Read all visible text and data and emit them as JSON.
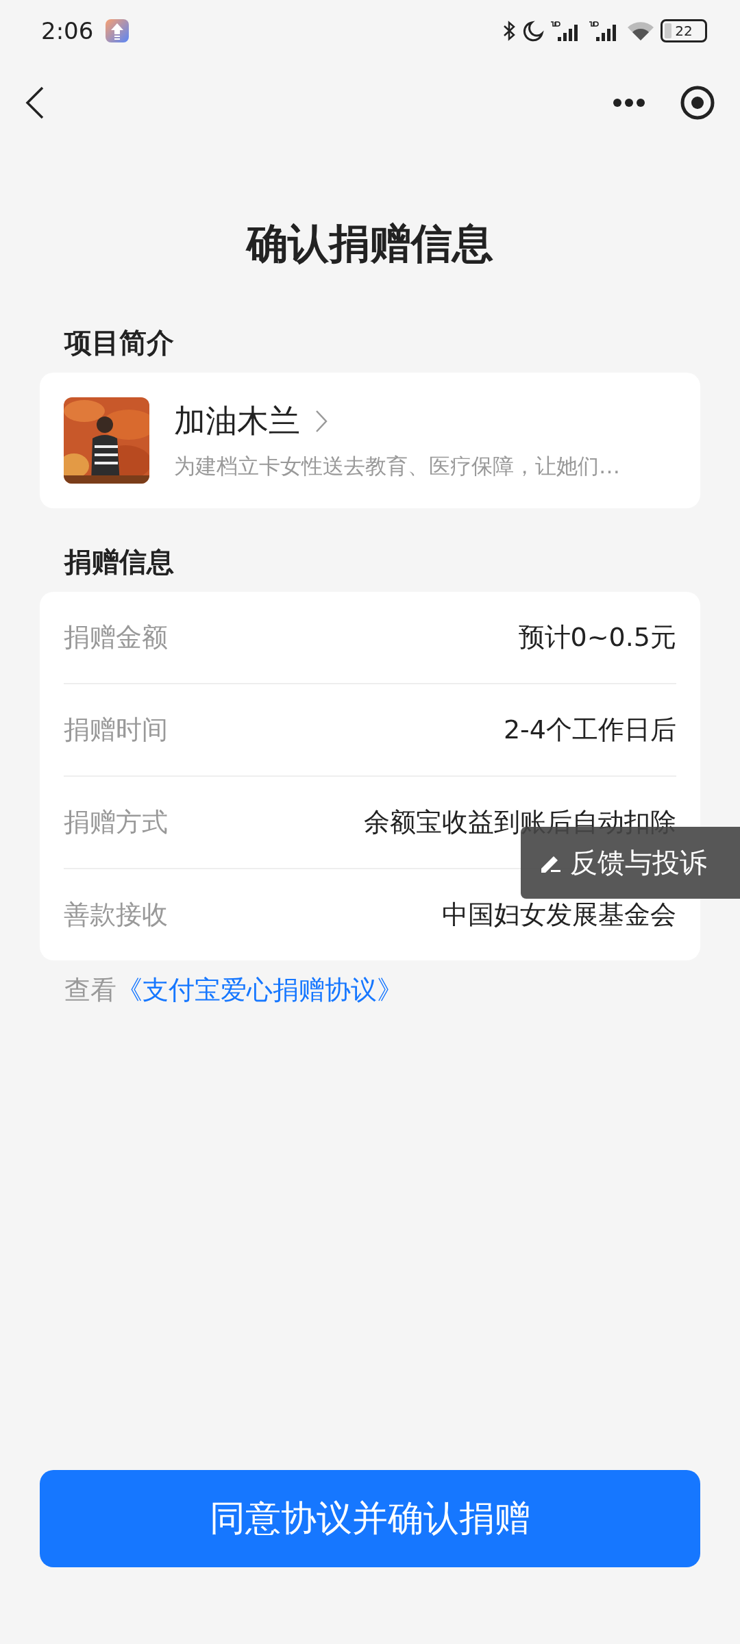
{
  "status_bar": {
    "time": "2:06",
    "battery": "22"
  },
  "page_title": "确认捐赠信息",
  "project_section": {
    "heading": "项目简介",
    "project": {
      "kind": "picture",
      "name": "加油木兰",
      "description": "为建档立卡女性送去教育、医疗保障，让她们…"
    }
  },
  "donation_section": {
    "heading": "捐赠信息",
    "rows": [
      {
        "label": "捐赠金额",
        "value": "预计0~0.5元"
      },
      {
        "label": "捐赠时间",
        "value": "2-4个工作日后"
      },
      {
        "label": "捐赠方式",
        "value": "余额宝收益到账后自动扣除"
      },
      {
        "label": "善款接收",
        "value": "中国妇女发展基金会"
      }
    ]
  },
  "agreement": {
    "prefix": "查看",
    "link": "《支付宝爱心捐赠协议》"
  },
  "feedback_button": "反馈与投诉",
  "confirm_button": "同意协议并确认捐赠"
}
